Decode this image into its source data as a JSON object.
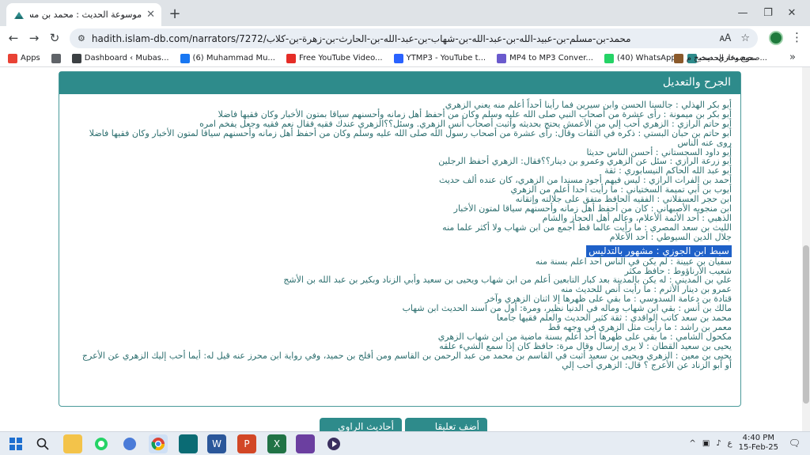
{
  "browser": {
    "tab_title": "موسوعة الحديث : محمد بن مسلم...",
    "url": "hadith.islam-db.com/narrators/7272/محمد-بن-مسلم-بن-عبيد-الله-بن-عبد-الله-بن-شهاب-بن-عبد-الله-بن-الحارث-بن-زهرة-بن-كلاب",
    "new_tab": "+",
    "tab_close": "✕",
    "back": "←",
    "forward": "→",
    "reload": "↻",
    "minimize": "—",
    "restore": "❐",
    "close": "✕",
    "kebab": "⋮"
  },
  "bookmarks": {
    "items": [
      {
        "label": "Apps",
        "icon": "apps-grid-icon",
        "color": "#e94235"
      },
      {
        "label": "",
        "icon": "grid-icon",
        "color": "#5f6368"
      },
      {
        "label": "Dashboard ‹ Mubas...",
        "icon": "wordpress-icon",
        "color": "#3c4043"
      },
      {
        "label": "(6) Muhammad Mu...",
        "icon": "facebook-icon",
        "color": "#1877f2"
      },
      {
        "label": "Free YouTube Video...",
        "icon": "youtube-icon",
        "color": "#e52d27"
      },
      {
        "label": "YTMP3 - YouTube t...",
        "icon": "ytmp3-icon",
        "color": "#2962ff"
      },
      {
        "label": "MP4 to MP3 Conver...",
        "icon": "convert-icon",
        "color": "#6a5acd"
      },
      {
        "label": "(40) WhatsApp",
        "icon": "whatsapp-icon",
        "color": "#25d366"
      },
      {
        "label": "موسوعة الحديث",
        "icon": "hadith-icon",
        "color": "#2e8b8b"
      },
      {
        "label": "صحيح بخاري، صحيح م...",
        "icon": "book-icon",
        "color": "#8b5a2b"
      }
    ],
    "more": "»"
  },
  "panel": {
    "title": "الجرح والتعديل",
    "narrators": [
      {
        "name": "أبو بكر الهذلي",
        "text": "جالسنا الحسن وابن سيرين فما رأينا أحداً أعلم منه يعني الزهري"
      },
      {
        "name": "أبو بكر بن ميمونة",
        "text": "رأى عشرة من أصحاب النبي صلى الله عليه وسلم وكان من أحفظ أهل زمانه وأحسنهم سياقا بمتون الأخبار وكان فقيها فاضلا"
      },
      {
        "name": "أبو حاتم الرازي",
        "text": "الزهري أحب إلي من الأعمش يحتج بحديثه وأثبت أصحاب أنس الزهري. وسئل؟؟الزهري عندك فقيه فقال نعم فقيه وجعل يفخم امره"
      },
      {
        "name": "أبو حاتم بن حبان البستي",
        "text": "ذكره في الثقات وقال: رأى عشرة من أصحاب رسول الله صلى الله عليه وسلم وكان من أحفظ أهل زمانه وأحسنهم سياقا لمتون الأخبار وكان فقيها فاضلا روى عنه الناس"
      },
      {
        "name": "أبو داود السجستاني",
        "text": "أحسن الناس حديثا"
      },
      {
        "name": "أبو زرعة الرازي",
        "text": "سئل عن الزهري وعمرو بن دينار؟؟فقال: الزهري أحفظ الرجلين"
      },
      {
        "name": "أبو عبد الله الحاكم النيسابوري",
        "text": "ثقة"
      },
      {
        "name": "أحمد بن الفرات الرازي",
        "text": "ليس فيهم أجود مسندا من الزهري، كان عنده ألف حديث"
      },
      {
        "name": "أيوب بن أبي تميمة السختياني",
        "text": "ما رأيت أحدا أعلم من الزهري"
      },
      {
        "name": "ابن حجر العسقلاني",
        "text": "الفقيه الحافظ متفق على جلالته وإتقانه"
      },
      {
        "name": "ابن منجويه الأصبهاني",
        "text": "كان من أحفظ أهل زمانه وأحسنهم سياقا لمتون الأخبار"
      },
      {
        "name": "الذهبي",
        "text": "أحد الأئمة الأعلام، وعالم أهل الحجاز والشام"
      },
      {
        "name": "الليث بن سعد المصري",
        "text": "ما رأيت عالما قط أجمع من ابن شهاب ولا أكثر علما منه"
      },
      {
        "name": "جلال الدين السيوطي",
        "text": "أحد الأعلام"
      },
      {
        "name": "سبط ابن الجوزي",
        "text": "مشهور بالتدليس",
        "selected": true
      },
      {
        "name": "سفيان بن عيينة",
        "text": "لم يكن في الناس أحد اعلم بسنة منه"
      },
      {
        "name": "شعيب الأرناؤوط",
        "text": "حافظ مكثر"
      },
      {
        "name": "علي بن المديني",
        "text": "له يكن بالمدينة بعد كبار التابعين أعلم من ابن شهاب ويحيى بن سعيد وأبي الزناد وبكير بن عبد الله بن الأشج"
      },
      {
        "name": "عمرو بن دينار الأثرم",
        "text": "ما رأيت أنص للحديث منه"
      },
      {
        "name": "قتادة بن دعامة السدوسي",
        "text": "ما بقي على ظهرها إلا اثنان الزهري وآخر"
      },
      {
        "name": "مالك بن أنس",
        "text": "بقي ابن شهاب وماله في الدنيا نظير، ومرة: أول من اسند الحديث ابن شهاب"
      },
      {
        "name": "محمد بن سعد كاتب الواقدي",
        "text": "ثقة كثير الحديث والعلم فقيها جامعا"
      },
      {
        "name": "معمر بن راشد",
        "text": "ما رأيت مثل الزهري في وجهه قط"
      },
      {
        "name": "مكحول الشامي",
        "text": "ما بقي على ظهرها أحد أعلم بسنة ماضية من ابن شهاب الزهري"
      },
      {
        "name": "يحيى بن سعيد القطان",
        "text": "لا يرى إرسال وقال مرة: حافظ كان إذا سمع الشيء علقه"
      },
      {
        "name": "يحيى بن معين",
        "text": "الزهري ويحيى بن سعيد أثبت في القاسم بن محمد من عبد الرحمن بن القاسم ومن أفلح بن حميد، وفي رواية ابن محرز عنه قيل له: أيما أحب إليك الزهري عن الأعرج أو أبو الزناد عن الأعرج ؟ قال: الزهري أحب إلي"
      }
    ],
    "buttons": [
      "أضف تعليقا",
      "أحاديث الراوي"
    ]
  },
  "taskbar": {
    "time": "4:40 PM",
    "date": "15-Feb-25",
    "lang": "ع",
    "tray_caret": "^"
  }
}
